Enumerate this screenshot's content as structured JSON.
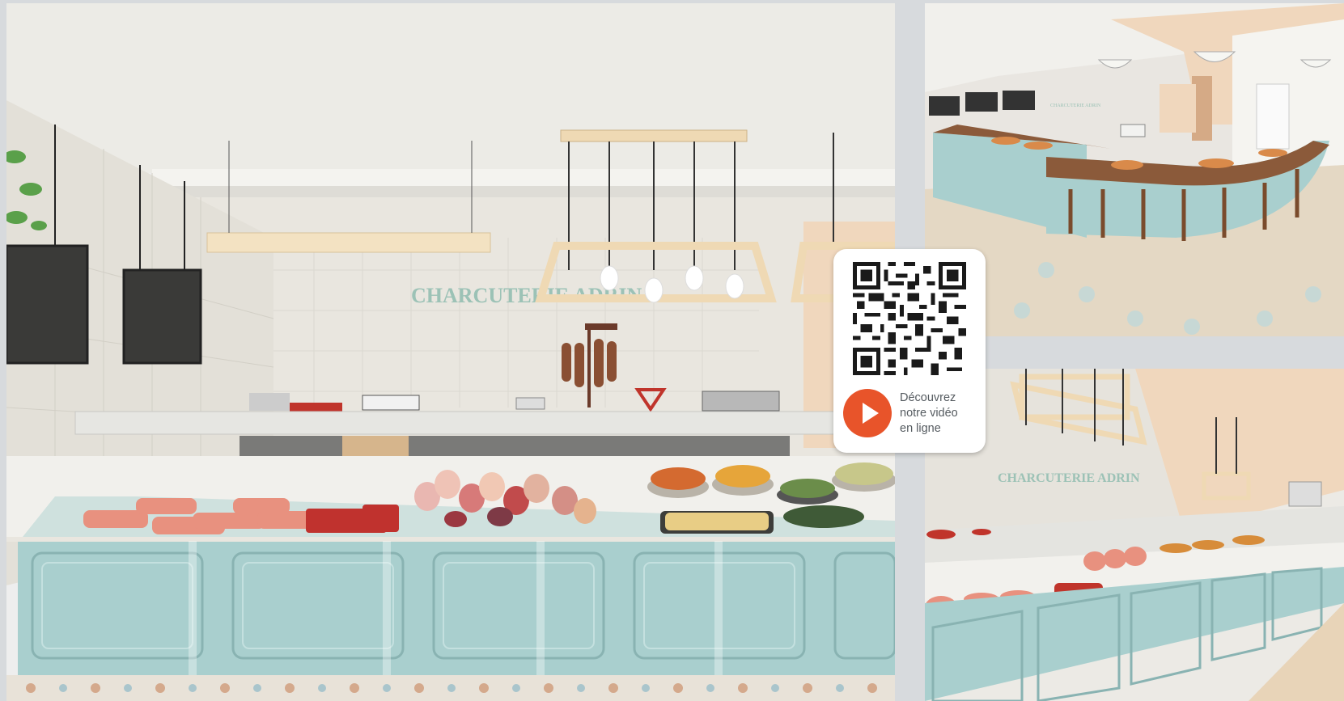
{
  "panels": {
    "main": {
      "sign_text": "CHARCUTERIE ADRIN"
    },
    "top_right": {
      "sign_text": "CHARCUTERIE ADRIN"
    },
    "bottom_right": {
      "sign_text": "CHARCUTERIE ADRIN"
    }
  },
  "video_card": {
    "caption_lines": [
      "Découvrez",
      "notre vidéo",
      "en ligne"
    ],
    "icons": {
      "qr": "qr-code-icon",
      "play": "play-icon"
    },
    "accent_color": "#e8542a"
  },
  "colors": {
    "counter_blue": "#a9cfce",
    "wall": "#ebe8e2",
    "wood": "#efd9b4",
    "sign_green": "#9cc2b6"
  }
}
